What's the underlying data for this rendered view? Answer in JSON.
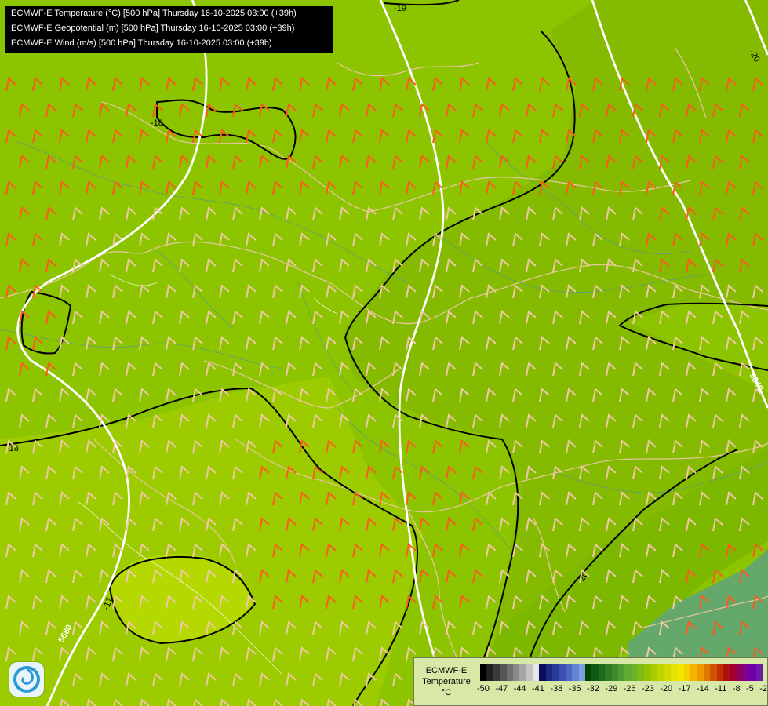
{
  "header": {
    "lines": [
      "ECMWF-E Temperature (°C) [500 hPa] Thursday 16-10-2025 03:00 (+39h)",
      "ECMWF-E Geopotential (m) [500 hPa] Thursday 16-10-2025 03:00 (+39h)",
      "ECMWF-E Wind (m/s) [500 hPa] Thursday 16-10-2025 03:00 (+39h)"
    ]
  },
  "map": {
    "temperature_contours": [
      "-19",
      "-20",
      "-18",
      "-18",
      "-17",
      "-20"
    ],
    "geopotential_contours": [
      "5640",
      "5680"
    ],
    "wind_barb_colors": {
      "strong": "#ff5a1e",
      "weak": "#f2c8a6"
    },
    "background_colors": [
      "#8cc400",
      "#84bb00",
      "#7cb800",
      "#9ccb00",
      "#b4d800",
      "#64a86c"
    ]
  },
  "legend": {
    "title_line1": "ECMWF-E",
    "title_line2": "Temperature",
    "title_line3": "°C",
    "ticks": [
      "-50",
      "-47",
      "-44",
      "-41",
      "-38",
      "-35",
      "-32",
      "-29",
      "-26",
      "-23",
      "-20",
      "-17",
      "-14",
      "-11",
      "-8",
      "-5",
      "-2"
    ],
    "colors": [
      "#000000",
      "#202020",
      "#3a3a3a",
      "#555555",
      "#707070",
      "#8a8a8a",
      "#a6a6a6",
      "#c4c4c4",
      "#e6e6e6",
      "#0a0a60",
      "#1a2a80",
      "#2a3c9a",
      "#3c50b0",
      "#5068c4",
      "#6684d6",
      "#7ea0e2",
      "#004400",
      "#0e5a10",
      "#206a1e",
      "#2e7a26",
      "#3c8a2e",
      "#4e9a34",
      "#5eaa34",
      "#6cb428",
      "#80bc14",
      "#94c400",
      "#aacc00",
      "#bed400",
      "#d0dc00",
      "#e4e400",
      "#f2e600",
      "#f8d000",
      "#f4b400",
      "#ec9800",
      "#e07800",
      "#d05400",
      "#c03000",
      "#b01010",
      "#a00030",
      "#900060",
      "#800090",
      "#7000a8",
      "#6a1aa8"
    ]
  }
}
